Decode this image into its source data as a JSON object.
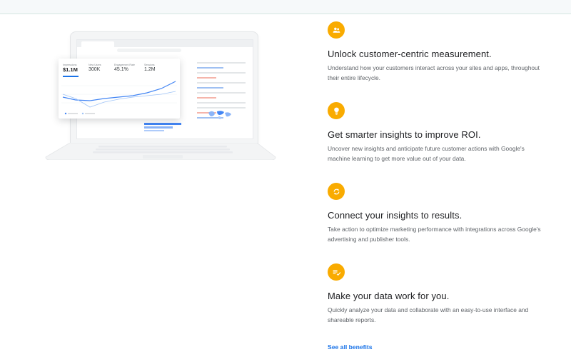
{
  "colors": {
    "accent_badge": "#f9ab00",
    "link": "#1a73e8",
    "title_text": "#202124",
    "body_text": "#5f6368"
  },
  "illustration": {
    "name": "laptop-analytics-dashboard",
    "metrics": [
      {
        "label": "Impressions",
        "value": "$1.1M"
      },
      {
        "label": "New Users",
        "value": "300K"
      },
      {
        "label": "Engagement Rate",
        "value": "45.1%"
      },
      {
        "label": "Sessions",
        "value": "1.2M"
      }
    ]
  },
  "benefits": [
    {
      "icon": "people-icon",
      "title": "Unlock customer-centric measurement.",
      "description": "Understand how your customers interact across your sites and apps, throughout their entire lifecycle."
    },
    {
      "icon": "lightbulb-icon",
      "title": "Get smarter insights to improve ROI.",
      "description": "Uncover new insights and anticipate future customer actions with Google's machine learning to get more value out of your data."
    },
    {
      "icon": "sync-icon",
      "title": "Connect your insights to results.",
      "description": "Take action to optimize marketing performance with integrations across Google's advertising and publisher tools."
    },
    {
      "icon": "checklist-icon",
      "title": "Make your data work for you.",
      "description": "Quickly analyze your data and collaborate with an easy-to-use interface and shareable reports."
    }
  ],
  "see_all_link": "See all benefits"
}
